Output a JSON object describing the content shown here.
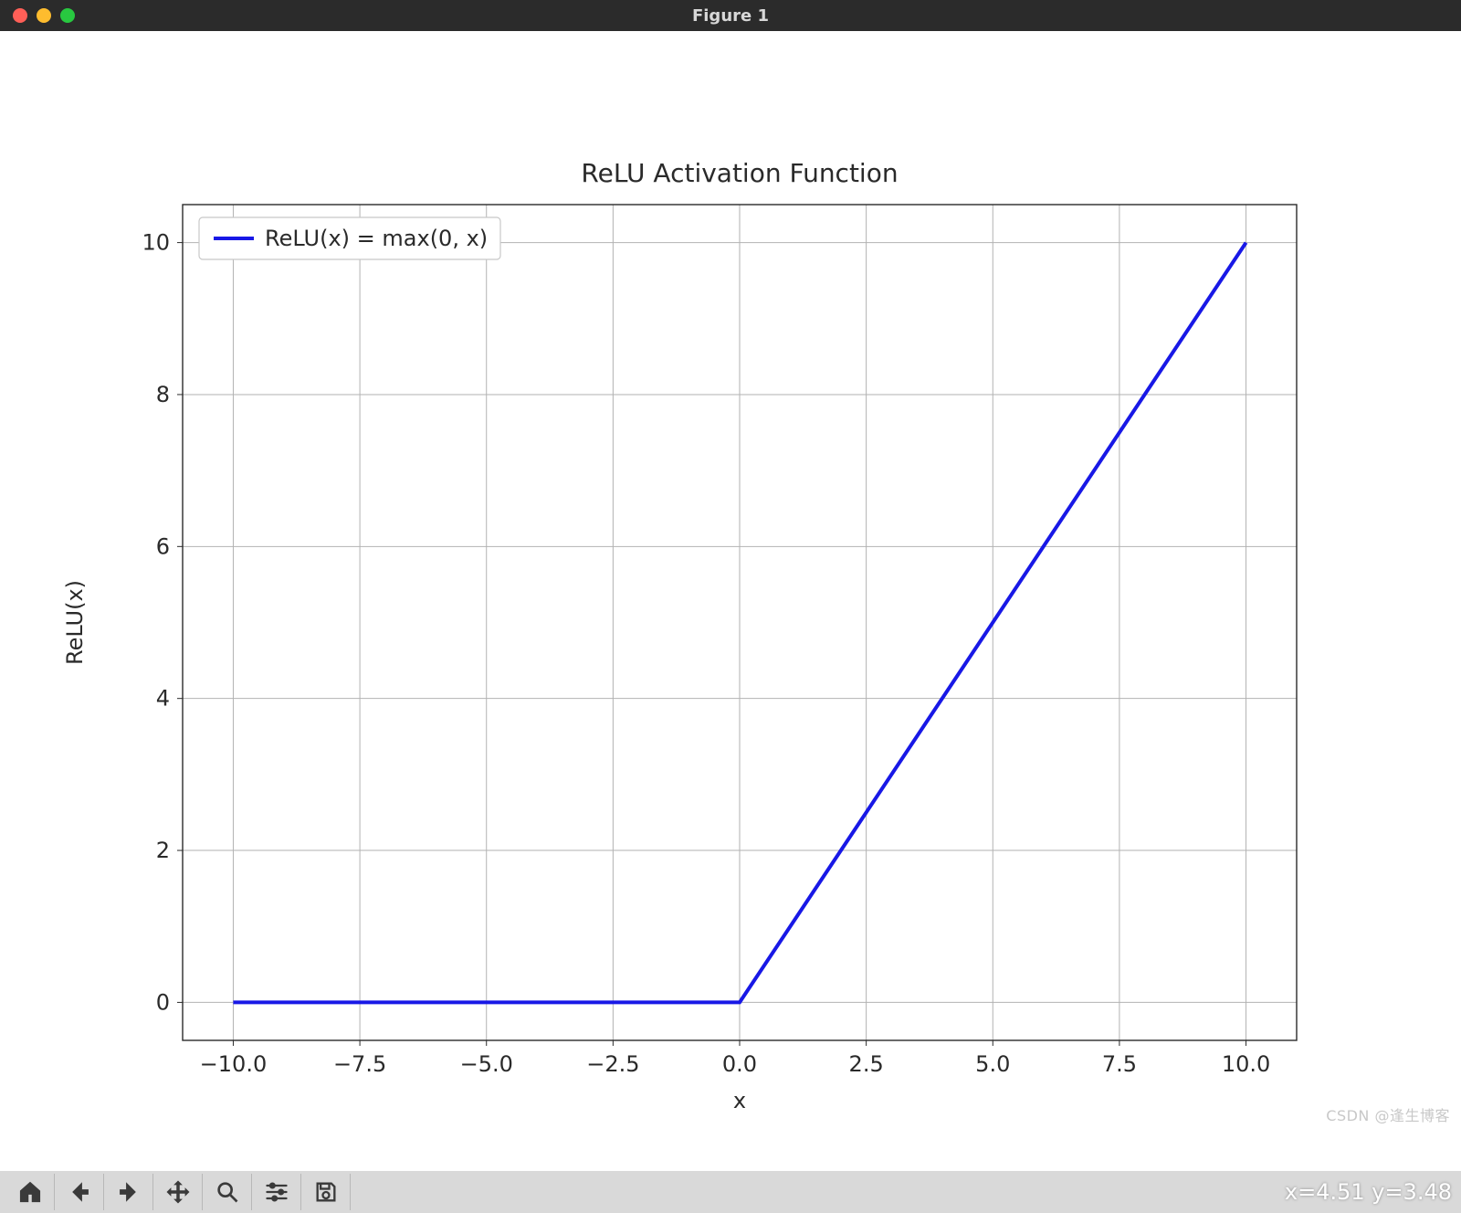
{
  "window": {
    "title": "Figure 1"
  },
  "chart_data": {
    "type": "line",
    "title": "ReLU Activation Function",
    "xlabel": "x",
    "ylabel": "ReLU(x)",
    "xlim": [
      -11,
      11
    ],
    "ylim": [
      -0.5,
      10.5
    ],
    "xticks": [
      -10.0,
      -7.5,
      -5.0,
      -2.5,
      0.0,
      2.5,
      5.0,
      7.5,
      10.0
    ],
    "yticks": [
      0,
      2,
      4,
      6,
      8,
      10
    ],
    "xtick_labels": [
      "−10.0",
      "−7.5",
      "−5.0",
      "−2.5",
      "0.0",
      "2.5",
      "5.0",
      "7.5",
      "10.0"
    ],
    "ytick_labels": [
      "0",
      "2",
      "4",
      "6",
      "8",
      "10"
    ],
    "line_color": "#1818e6",
    "grid_color": "#b2b2b2",
    "series": [
      {
        "name": "ReLU(x) = max(0, x)",
        "x": [
          -10,
          -7.5,
          -5,
          -2.5,
          0,
          2.5,
          5,
          7.5,
          10
        ],
        "y": [
          0,
          0,
          0,
          0,
          0,
          2.5,
          5,
          7.5,
          10
        ]
      }
    ],
    "legend": {
      "position": "upper-left"
    }
  },
  "toolbar": {
    "buttons": [
      "home",
      "back",
      "forward",
      "pan",
      "zoom",
      "configure",
      "save"
    ],
    "coord_readout": "x=4.51 y=3.48"
  },
  "watermark": "CSDN @逢生博客"
}
